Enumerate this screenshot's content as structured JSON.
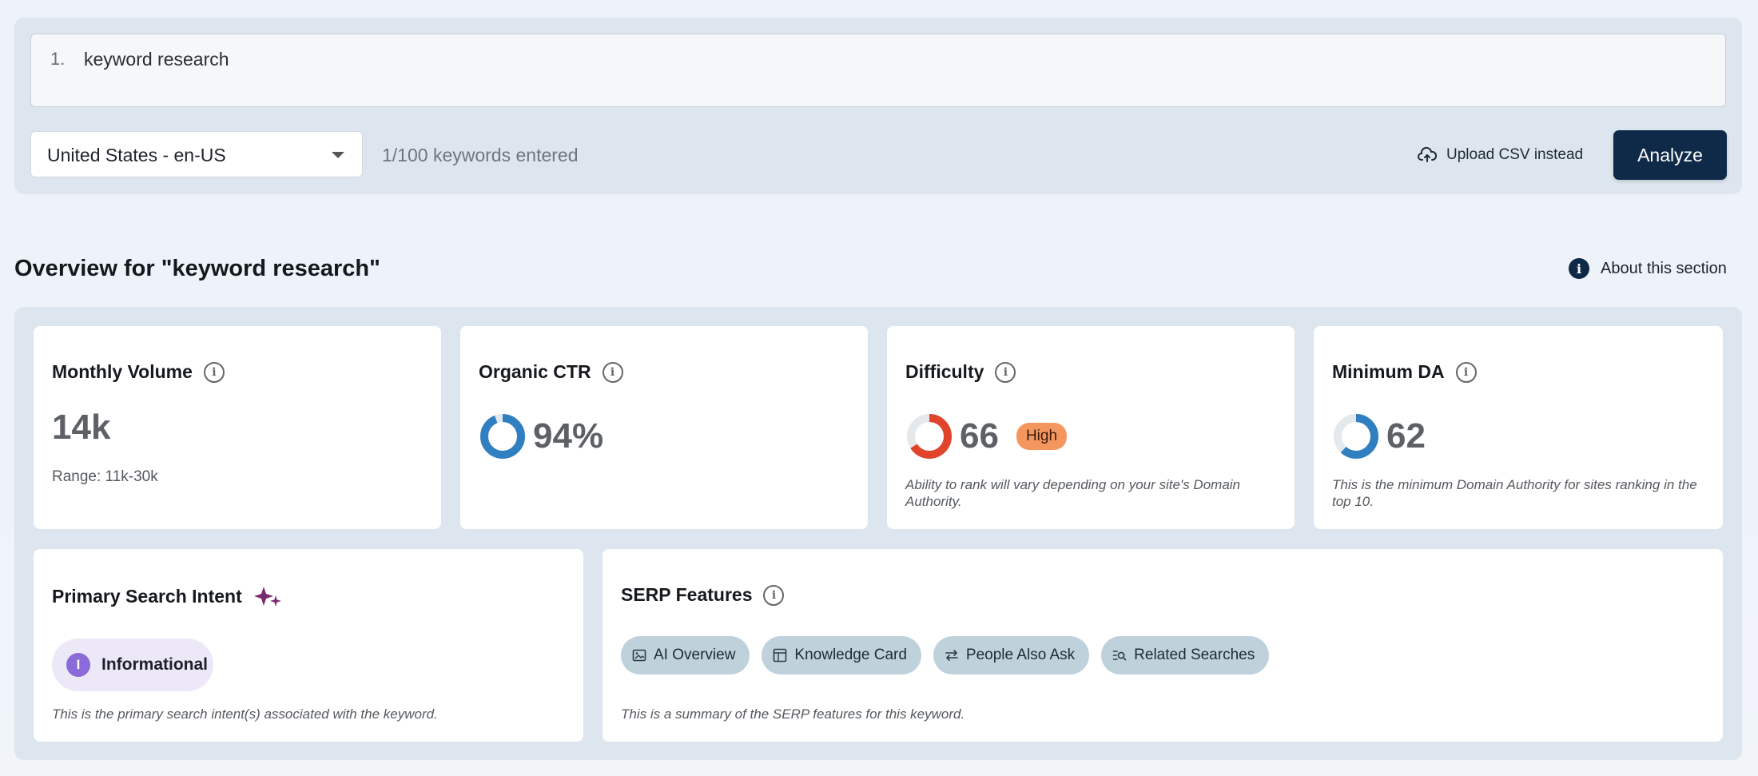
{
  "input": {
    "line_number": "1.",
    "keyword": "keyword research"
  },
  "locale": {
    "selected": "United States - en-US"
  },
  "keyword_count": "1/100 keywords entered",
  "upload_label": "Upload CSV instead",
  "analyze_label": "Analyze",
  "overview": {
    "title": "Overview for \"keyword research\"",
    "about_label": "About this section",
    "about_icon": "i"
  },
  "cards": {
    "volume": {
      "title": "Monthly Volume",
      "value": "14k",
      "range": "Range: 11k-30k"
    },
    "ctr": {
      "title": "Organic CTR",
      "value": "94%",
      "fraction": 0.94
    },
    "difficulty": {
      "title": "Difficulty",
      "value": "66",
      "fraction": 0.66,
      "badge": "High",
      "note": "Ability to rank will vary depending on your site's Domain Authority."
    },
    "min_da": {
      "title": "Minimum DA",
      "value": "62",
      "fraction": 0.62,
      "note": "This is the minimum Domain Authority for sites ranking in the top 10."
    },
    "intent": {
      "title": "Primary Search Intent",
      "pill_letter": "I",
      "pill_label": "Informational",
      "note": "This is the primary search intent(s) associated with the keyword."
    },
    "serp": {
      "title": "SERP Features",
      "chips": [
        "AI Overview",
        "Knowledge Card",
        "People Also Ask",
        "Related Searches"
      ],
      "note": "This is a summary of the SERP features for this keyword."
    }
  },
  "colors": {
    "primary": "#0e2a48",
    "ctr_ring": "#2f7fc1",
    "difficulty_ring": "#e0452c",
    "da_ring": "#2f7fc1",
    "high_badge": "#f4975f",
    "intent": "#8b6bd9",
    "sparkle": "#7a2a6e"
  }
}
